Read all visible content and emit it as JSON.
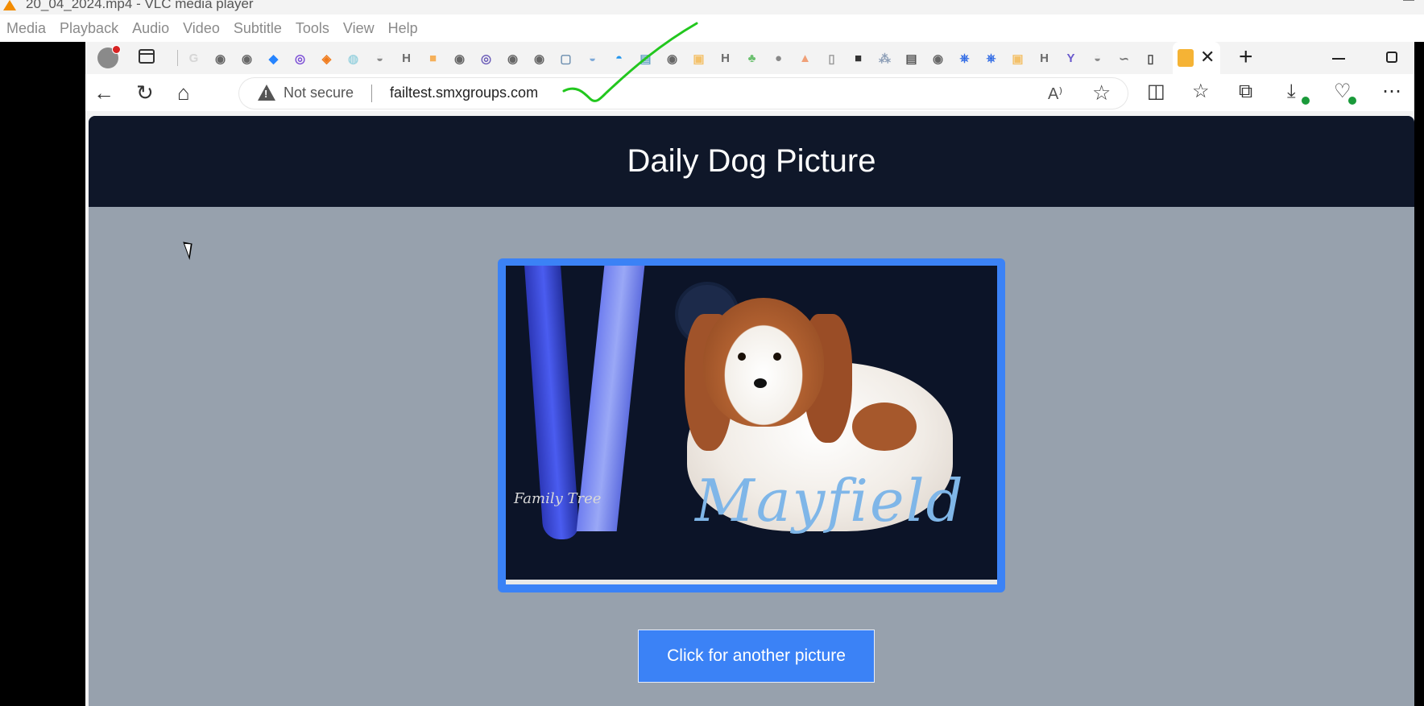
{
  "vlc": {
    "window_title": "20_04_2024.mp4 - VLC media player",
    "menu": [
      "Media",
      "Playback",
      "Audio",
      "Video",
      "Subtitle",
      "Tools",
      "View",
      "Help"
    ]
  },
  "browser": {
    "pinned_tabs": [
      {
        "icon": "google-icon",
        "glyph": "G",
        "color": "#d6d6d6"
      },
      {
        "icon": "github-icon",
        "glyph": "◉",
        "color": "#666666"
      },
      {
        "icon": "github-icon",
        "glyph": "◉",
        "color": "#666666"
      },
      {
        "icon": "bitbucket-icon",
        "glyph": "◆",
        "color": "#2684ff"
      },
      {
        "icon": "app-icon",
        "glyph": "◎",
        "color": "#7b4dd6"
      },
      {
        "icon": "app-icon",
        "glyph": "◈",
        "color": "#f07a1a"
      },
      {
        "icon": "app-icon",
        "glyph": "◍",
        "color": "#9fd4e0"
      },
      {
        "icon": "docker-icon",
        "glyph": "◒",
        "color": "#8c8c8c"
      },
      {
        "icon": "hashicorp-icon",
        "glyph": "H",
        "color": "#6b6b6b"
      },
      {
        "icon": "app-icon",
        "glyph": "■",
        "color": "#f5b05a"
      },
      {
        "icon": "github-icon",
        "glyph": "◉",
        "color": "#666666"
      },
      {
        "icon": "app-icon",
        "glyph": "◎",
        "color": "#6b5cb8"
      },
      {
        "icon": "github-icon",
        "glyph": "◉",
        "color": "#666666"
      },
      {
        "icon": "github-icon",
        "glyph": "◉",
        "color": "#666666"
      },
      {
        "icon": "app-icon",
        "glyph": "▢",
        "color": "#6d8fb0"
      },
      {
        "icon": "docker-icon",
        "glyph": "◒",
        "color": "#7ea9d8"
      },
      {
        "icon": "docker-icon",
        "glyph": "◓",
        "color": "#2496ed"
      },
      {
        "icon": "app-icon",
        "glyph": "▤",
        "color": "#6aa6c8"
      },
      {
        "icon": "github-icon",
        "glyph": "◉",
        "color": "#666666"
      },
      {
        "icon": "app-icon",
        "glyph": "▣",
        "color": "#f3c16a"
      },
      {
        "icon": "hashicorp-icon",
        "glyph": "H",
        "color": "#6b6b6b"
      },
      {
        "icon": "app-icon",
        "glyph": "♣",
        "color": "#6cc070"
      },
      {
        "icon": "app-icon",
        "glyph": "●",
        "color": "#888888"
      },
      {
        "icon": "app-icon",
        "glyph": "▲",
        "color": "#f0a078"
      },
      {
        "icon": "page-icon",
        "glyph": "▯",
        "color": "#999999"
      },
      {
        "icon": "app-icon",
        "glyph": "■",
        "color": "#333333"
      },
      {
        "icon": "app-icon",
        "glyph": "⁂",
        "color": "#8fa0b8"
      },
      {
        "icon": "aws-icon",
        "glyph": "▤",
        "color": "#555555"
      },
      {
        "icon": "github-icon",
        "glyph": "◉",
        "color": "#666666"
      },
      {
        "icon": "kubernetes-icon",
        "glyph": "⎈",
        "color": "#326ce5"
      },
      {
        "icon": "kubernetes-icon",
        "glyph": "⎈",
        "color": "#326ce5"
      },
      {
        "icon": "app-icon",
        "glyph": "▣",
        "color": "#f3c16a"
      },
      {
        "icon": "hashicorp-icon",
        "glyph": "H",
        "color": "#6b6b6b"
      },
      {
        "icon": "app-icon",
        "glyph": "Y",
        "color": "#6a5acd"
      },
      {
        "icon": "docker-icon",
        "glyph": "◒",
        "color": "#8c8c8c"
      },
      {
        "icon": "app-icon",
        "glyph": "∽",
        "color": "#777777"
      },
      {
        "icon": "page-icon",
        "glyph": "▯",
        "color": "#444444"
      }
    ],
    "active_tab_close": "✕",
    "new_tab": "+",
    "address_bar": {
      "security_label": "Not secure",
      "url": "failtest.smxgroups.com"
    }
  },
  "page": {
    "heading": "Daily Dog Picture",
    "photo": {
      "watermark": "Family Tree",
      "signature": "Mayfield"
    },
    "button_label": "Click for another picture"
  },
  "colors": {
    "header_bg": "#0f1729",
    "page_bg": "#97a1ad",
    "accent": "#3b82f6",
    "annotation": "#22c71e"
  }
}
